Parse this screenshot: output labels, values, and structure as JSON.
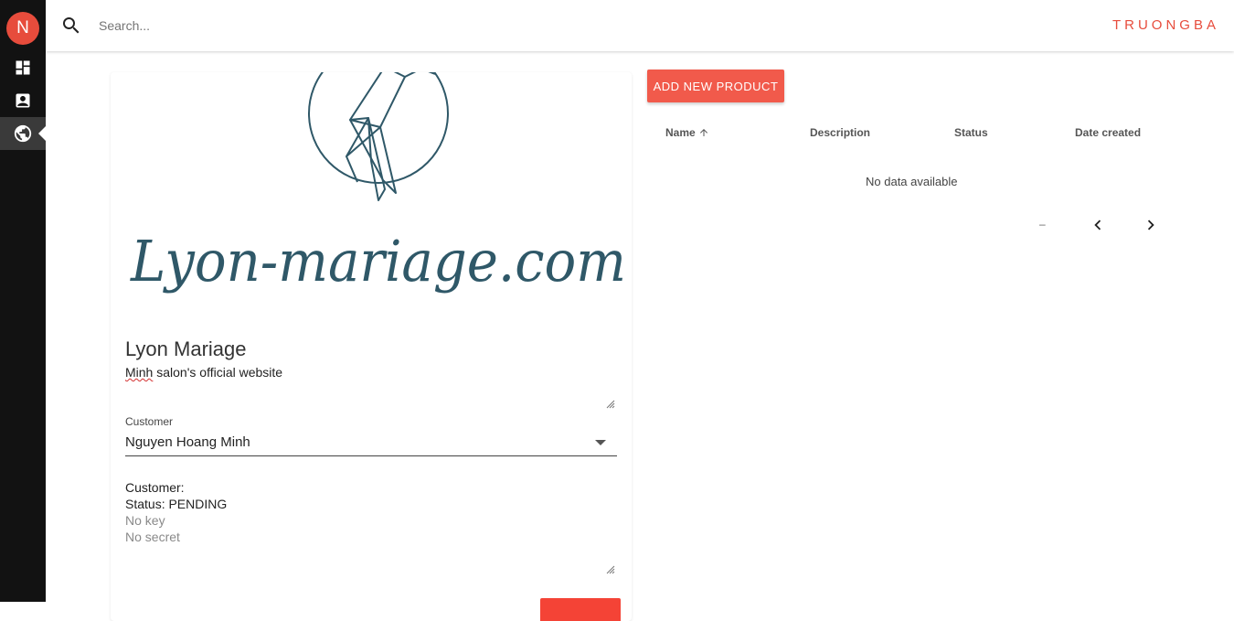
{
  "sidebar": {
    "avatar_letter": "N",
    "items": [
      {
        "icon": "dashboard-icon"
      },
      {
        "icon": "contacts-icon"
      },
      {
        "icon": "public-globe-icon",
        "active": true
      }
    ]
  },
  "topbar": {
    "search_placeholder": "Search...",
    "brand": "TRUONGBA"
  },
  "website_card": {
    "logo_text": "Lyon-mariage.com",
    "title": "Lyon Mariage",
    "description_underlined": "Minh",
    "description_rest": " salon's official website",
    "customer_label": "Customer",
    "customer_value": "Nguyen Hoang Minh",
    "info_customer": "Customer:",
    "info_status": "Status: PENDING",
    "info_key": "No key",
    "info_secret": "No secret"
  },
  "products": {
    "add_button": "ADD NEW PRODUCT",
    "columns": [
      "Name",
      "Description",
      "Status",
      "Date created"
    ],
    "empty_text": "No data available",
    "page_range": "–"
  },
  "colors": {
    "accent": "#f15a4b",
    "brand": "#e74c3c",
    "sidebar": "#121212",
    "logo": "#2f5868"
  }
}
